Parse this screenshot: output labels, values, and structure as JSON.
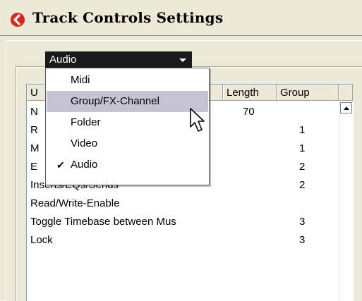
{
  "window": {
    "title": "Track Controls Settings"
  },
  "type_select": {
    "value": "Audio"
  },
  "dropdown": {
    "options": [
      {
        "label": "Midi",
        "checked": false,
        "highlighted": false
      },
      {
        "label": "Group/FX-Channel",
        "checked": false,
        "highlighted": true
      },
      {
        "label": "Folder",
        "checked": false,
        "highlighted": false
      },
      {
        "label": "Video",
        "checked": false,
        "highlighted": false
      },
      {
        "label": "Audio",
        "checked": true,
        "highlighted": false
      }
    ],
    "check_glyph": "✔"
  },
  "table": {
    "headers": [
      "U",
      "Length",
      "Group"
    ],
    "rows": [
      {
        "name": "N",
        "length": "70",
        "group": ""
      },
      {
        "name": "R",
        "length": "",
        "group": "1"
      },
      {
        "name": "M",
        "length": "",
        "group": "1"
      },
      {
        "name": "E",
        "length": "",
        "group": "2"
      },
      {
        "name": "Inserts/EQs/Sends",
        "length": "",
        "group": "2"
      },
      {
        "name": "Read/Write-Enable",
        "length": "",
        "group": ""
      },
      {
        "name": "Toggle Timebase between Mus",
        "length": "",
        "group": "3"
      },
      {
        "name": "Lock",
        "length": "",
        "group": "3"
      }
    ]
  },
  "colors": {
    "app_icon": "#d9261c",
    "select_bg": "#1a1a1a",
    "highlight": "#c5c3d4"
  },
  "icons": {
    "app": "app-logo-icon",
    "cursor": "mouse-pointer-icon",
    "scroll_up": "scroll-up-arrow-icon",
    "select_arrow": "dropdown-arrow-icon"
  }
}
